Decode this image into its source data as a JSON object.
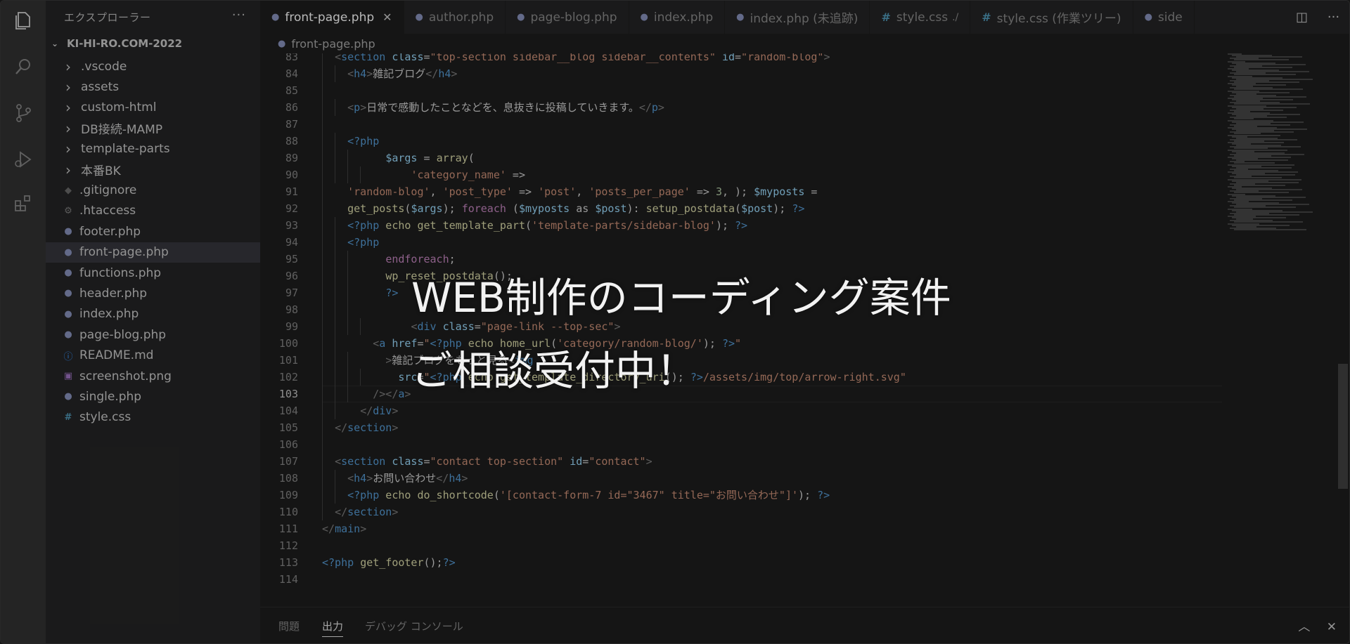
{
  "sidebar": {
    "title": "エクスプローラー",
    "more": "···",
    "project": "KI-HI-RO.COM-2022",
    "items": [
      {
        "label": ".vscode",
        "kind": "folder"
      },
      {
        "label": "assets",
        "kind": "folder"
      },
      {
        "label": "custom-html",
        "kind": "folder"
      },
      {
        "label": "DB接続-MAMP",
        "kind": "folder"
      },
      {
        "label": "template-parts",
        "kind": "folder"
      },
      {
        "label": "本番BK",
        "kind": "folder"
      },
      {
        "label": ".gitignore",
        "kind": "git"
      },
      {
        "label": ".htaccess",
        "kind": "gear"
      },
      {
        "label": "footer.php",
        "kind": "php"
      },
      {
        "label": "front-page.php",
        "kind": "php",
        "selected": true
      },
      {
        "label": "functions.php",
        "kind": "php"
      },
      {
        "label": "header.php",
        "kind": "php"
      },
      {
        "label": "index.php",
        "kind": "php"
      },
      {
        "label": "page-blog.php",
        "kind": "php"
      },
      {
        "label": "README.md",
        "kind": "info"
      },
      {
        "label": "screenshot.png",
        "kind": "img"
      },
      {
        "label": "single.php",
        "kind": "php"
      },
      {
        "label": "style.css",
        "kind": "css"
      }
    ]
  },
  "tabs": [
    {
      "label": "front-page.php",
      "icon": "php",
      "active": true
    },
    {
      "label": "author.php",
      "icon": "php"
    },
    {
      "label": "page-blog.php",
      "icon": "php"
    },
    {
      "label": "index.php",
      "icon": "php"
    },
    {
      "label": "index.php (未追跡)",
      "icon": "php"
    },
    {
      "label": "style.css",
      "icon": "css",
      "desc": "./"
    },
    {
      "label": "style.css (作業ツリー)",
      "icon": "css"
    },
    {
      "label": "side",
      "icon": "php"
    }
  ],
  "breadcrumb": "front-page.php",
  "editor": {
    "current_line": 103,
    "lines": [
      {
        "n": 83,
        "indent": [
          1
        ],
        "tokens": [
          [
            "  ",
            "op"
          ],
          [
            "<",
            "br"
          ],
          [
            "section",
            "tag"
          ],
          [
            " ",
            "op"
          ],
          [
            "class",
            "attr"
          ],
          [
            "=",
            "op"
          ],
          [
            "\"top-section sidebar__blog sidebar__contents\"",
            "str"
          ],
          [
            " ",
            "op"
          ],
          [
            "id",
            "attr"
          ],
          [
            "=",
            "op"
          ],
          [
            "\"random-blog\"",
            "str"
          ],
          [
            ">",
            "br"
          ]
        ]
      },
      {
        "n": 84,
        "indent": [
          1,
          2
        ],
        "tokens": [
          [
            "    ",
            "op"
          ],
          [
            "<",
            "br"
          ],
          [
            "h4",
            "tag"
          ],
          [
            ">",
            "br"
          ],
          [
            "雑記ブログ",
            "txt"
          ],
          [
            "</",
            "br"
          ],
          [
            "h4",
            "tag"
          ],
          [
            ">",
            "br"
          ]
        ]
      },
      {
        "n": 85,
        "indent": [
          1
        ],
        "tokens": []
      },
      {
        "n": 86,
        "indent": [
          1,
          2
        ],
        "tokens": [
          [
            "    ",
            "op"
          ],
          [
            "<",
            "br"
          ],
          [
            "p",
            "tag"
          ],
          [
            ">",
            "br"
          ],
          [
            "日常で感動したことなどを、息抜きに投稿していきます。",
            "txt"
          ],
          [
            "</",
            "br"
          ],
          [
            "p",
            "tag"
          ],
          [
            ">",
            "br"
          ]
        ]
      },
      {
        "n": 87,
        "indent": [
          1
        ],
        "tokens": []
      },
      {
        "n": 88,
        "indent": [
          1,
          2
        ],
        "tokens": [
          [
            "    ",
            "op"
          ],
          [
            "<?php",
            "php"
          ]
        ]
      },
      {
        "n": 89,
        "indent": [
          1,
          2,
          3
        ],
        "tokens": [
          [
            "          ",
            "op"
          ],
          [
            "$args",
            "var"
          ],
          [
            " = ",
            "op"
          ],
          [
            "array",
            "fn"
          ],
          [
            "(",
            "op"
          ]
        ]
      },
      {
        "n": 90,
        "indent": [
          1,
          2,
          3,
          4
        ],
        "tokens": [
          [
            "              ",
            "op"
          ],
          [
            "'category_name'",
            "str"
          ],
          [
            " =>",
            "op"
          ]
        ]
      },
      {
        "n": 91,
        "indent": [
          1
        ],
        "tokens": [
          [
            "    ",
            "op"
          ],
          [
            "'random-blog'",
            "str"
          ],
          [
            ", ",
            "op"
          ],
          [
            "'post_type'",
            "str"
          ],
          [
            " => ",
            "op"
          ],
          [
            "'post'",
            "str"
          ],
          [
            ", ",
            "op"
          ],
          [
            "'posts_per_page'",
            "str"
          ],
          [
            " => ",
            "op"
          ],
          [
            "3",
            "num"
          ],
          [
            ", ); ",
            "op"
          ],
          [
            "$myposts",
            "var"
          ],
          [
            " =",
            "op"
          ]
        ]
      },
      {
        "n": 92,
        "indent": [
          1
        ],
        "tokens": [
          [
            "    ",
            "op"
          ],
          [
            "get_posts",
            "fn"
          ],
          [
            "(",
            "op"
          ],
          [
            "$args",
            "var"
          ],
          [
            "); ",
            "op"
          ],
          [
            "foreach",
            "kw"
          ],
          [
            " (",
            "op"
          ],
          [
            "$myposts",
            "var"
          ],
          [
            " as ",
            "op"
          ],
          [
            "$post",
            "var"
          ],
          [
            "): ",
            "op"
          ],
          [
            "setup_postdata",
            "fn"
          ],
          [
            "(",
            "op"
          ],
          [
            "$post",
            "var"
          ],
          [
            "); ",
            "op"
          ],
          [
            "?>",
            "php"
          ]
        ]
      },
      {
        "n": 93,
        "indent": [
          1,
          2
        ],
        "tokens": [
          [
            "    ",
            "op"
          ],
          [
            "<?php",
            "php"
          ],
          [
            " echo ",
            "fn"
          ],
          [
            "get_template_part",
            "fn"
          ],
          [
            "(",
            "op"
          ],
          [
            "'template-parts/sidebar-blog'",
            "str"
          ],
          [
            "); ",
            "op"
          ],
          [
            "?>",
            "php"
          ]
        ]
      },
      {
        "n": 94,
        "indent": [
          1,
          2
        ],
        "tokens": [
          [
            "    ",
            "op"
          ],
          [
            "<?php",
            "php"
          ]
        ]
      },
      {
        "n": 95,
        "indent": [
          1,
          2,
          3
        ],
        "tokens": [
          [
            "          ",
            "op"
          ],
          [
            "endforeach",
            "kw"
          ],
          [
            ";",
            "op"
          ]
        ]
      },
      {
        "n": 96,
        "indent": [
          1,
          2,
          3
        ],
        "tokens": [
          [
            "          ",
            "op"
          ],
          [
            "wp_reset_postdata",
            "fn"
          ],
          [
            "();",
            "op"
          ]
        ]
      },
      {
        "n": 97,
        "indent": [
          1,
          2,
          3
        ],
        "tokens": [
          [
            "          ",
            "op"
          ],
          [
            "?>",
            "php"
          ]
        ]
      },
      {
        "n": 98,
        "indent": [
          1,
          2,
          3
        ],
        "tokens": []
      },
      {
        "n": 99,
        "indent": [
          1,
          2,
          3,
          4
        ],
        "tokens": [
          [
            "              ",
            "op"
          ],
          [
            "<",
            "br"
          ],
          [
            "div",
            "tag"
          ],
          [
            " ",
            "op"
          ],
          [
            "class",
            "attr"
          ],
          [
            "=",
            "op"
          ],
          [
            "\"page-link --top-sec\"",
            "str"
          ],
          [
            ">",
            "br"
          ]
        ]
      },
      {
        "n": 100,
        "indent": [
          1,
          2
        ],
        "tokens": [
          [
            "        ",
            "op"
          ],
          [
            "<",
            "br"
          ],
          [
            "a",
            "tag"
          ],
          [
            " ",
            "op"
          ],
          [
            "href",
            "attr"
          ],
          [
            "=",
            "op"
          ],
          [
            "\"",
            "str"
          ],
          [
            "<?php",
            "php"
          ],
          [
            " echo ",
            "fn"
          ],
          [
            "home_url",
            "fn"
          ],
          [
            "(",
            "op"
          ],
          [
            "'category/random-blog/'",
            "str"
          ],
          [
            "); ",
            "op"
          ],
          [
            "?>",
            "php"
          ],
          [
            "\"",
            "str"
          ]
        ]
      },
      {
        "n": 101,
        "indent": [
          1,
          2,
          3
        ],
        "tokens": [
          [
            "          ",
            "op"
          ],
          [
            ">",
            "br"
          ],
          [
            "雑記ブログをもっと見る",
            "txt"
          ],
          [
            "<",
            "br"
          ],
          [
            "img",
            "tag"
          ]
        ]
      },
      {
        "n": 102,
        "indent": [
          1,
          2,
          3,
          4
        ],
        "tokens": [
          [
            "            ",
            "op"
          ],
          [
            "src",
            "attr"
          ],
          [
            "=",
            "op"
          ],
          [
            "\"",
            "str"
          ],
          [
            "<?php",
            "php"
          ],
          [
            " echo ",
            "fn"
          ],
          [
            "get_template_directory_uri",
            "fn"
          ],
          [
            "(); ",
            "op"
          ],
          [
            "?>",
            "php"
          ],
          [
            "/assets/img/top/arrow-right.svg\"",
            "str"
          ]
        ]
      },
      {
        "n": 103,
        "indent": [
          1,
          2,
          3
        ],
        "tokens": [
          [
            "        ",
            "op"
          ],
          [
            "/></",
            "br"
          ],
          [
            "a",
            "tag"
          ],
          [
            ">",
            "br"
          ]
        ]
      },
      {
        "n": 104,
        "indent": [
          1,
          2
        ],
        "tokens": [
          [
            "      ",
            "op"
          ],
          [
            "</",
            "br"
          ],
          [
            "div",
            "tag"
          ],
          [
            ">",
            "br"
          ]
        ]
      },
      {
        "n": 105,
        "indent": [
          1
        ],
        "tokens": [
          [
            "  ",
            "op"
          ],
          [
            "</",
            "br"
          ],
          [
            "section",
            "tag"
          ],
          [
            ">",
            "br"
          ]
        ]
      },
      {
        "n": 106,
        "indent": [
          1
        ],
        "tokens": []
      },
      {
        "n": 107,
        "indent": [
          1
        ],
        "tokens": [
          [
            "  ",
            "op"
          ],
          [
            "<",
            "br"
          ],
          [
            "section",
            "tag"
          ],
          [
            " ",
            "op"
          ],
          [
            "class",
            "attr"
          ],
          [
            "=",
            "op"
          ],
          [
            "\"contact top-section\"",
            "str"
          ],
          [
            " ",
            "op"
          ],
          [
            "id",
            "attr"
          ],
          [
            "=",
            "op"
          ],
          [
            "\"contact\"",
            "str"
          ],
          [
            ">",
            "br"
          ]
        ]
      },
      {
        "n": 108,
        "indent": [
          1,
          2
        ],
        "tokens": [
          [
            "    ",
            "op"
          ],
          [
            "<",
            "br"
          ],
          [
            "h4",
            "tag"
          ],
          [
            ">",
            "br"
          ],
          [
            "お問い合わせ",
            "txt"
          ],
          [
            "</",
            "br"
          ],
          [
            "h4",
            "tag"
          ],
          [
            ">",
            "br"
          ]
        ]
      },
      {
        "n": 109,
        "indent": [
          1,
          2
        ],
        "tokens": [
          [
            "    ",
            "op"
          ],
          [
            "<?php",
            "php"
          ],
          [
            " echo ",
            "fn"
          ],
          [
            "do_shortcode",
            "fn"
          ],
          [
            "(",
            "op"
          ],
          [
            "'[contact-form-7 id=\"3467\" title=\"お問い合わせ\"]'",
            "str"
          ],
          [
            "); ",
            "op"
          ],
          [
            "?>",
            "php"
          ]
        ]
      },
      {
        "n": 110,
        "indent": [
          1
        ],
        "tokens": [
          [
            "  ",
            "op"
          ],
          [
            "</",
            "br"
          ],
          [
            "section",
            "tag"
          ],
          [
            ">",
            "br"
          ]
        ]
      },
      {
        "n": 111,
        "indent": [],
        "tokens": [
          [
            "</",
            "br"
          ],
          [
            "main",
            "tag"
          ],
          [
            ">",
            "br"
          ]
        ]
      },
      {
        "n": 112,
        "indent": [],
        "tokens": []
      },
      {
        "n": 113,
        "indent": [],
        "tokens": [
          [
            "<?php",
            "php"
          ],
          [
            " ",
            "op"
          ],
          [
            "get_footer",
            "fn"
          ],
          [
            "();",
            "op"
          ],
          [
            "?>",
            "php"
          ]
        ]
      },
      {
        "n": 114,
        "indent": [],
        "tokens": []
      }
    ]
  },
  "panel": {
    "tabs": [
      {
        "label": "問題",
        "active": false
      },
      {
        "label": "出力",
        "active": true
      },
      {
        "label": "デバッグ コンソール",
        "active": false
      }
    ],
    "actions": [
      "︿",
      "✕"
    ]
  },
  "overlay": {
    "line1": "WEB制作のコーディング案件",
    "line2": "ご相談受付中！"
  }
}
